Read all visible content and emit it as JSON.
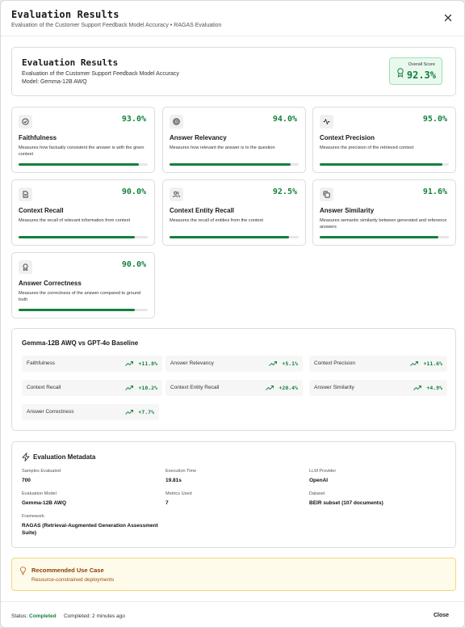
{
  "header": {
    "title": "Evaluation Results",
    "subtitle": "Evaluation of the Customer Support Feedback Model Accuracy • RAGAS Evaluation"
  },
  "summary": {
    "title": "Evaluation Results",
    "description": "Evaluation of the Customer Support Feedback Model Accuracy",
    "model": "Model: Gemma-12B AWQ",
    "overall_label": "Overall Score",
    "overall_value": "92.3%"
  },
  "metrics": [
    {
      "name": "Faithfulness",
      "value": "93.0%",
      "fraction": 0.93,
      "desc": "Measures how factually consistent the answer is with the given context",
      "icon": "check-circle-icon"
    },
    {
      "name": "Answer Relevancy",
      "value": "94.0%",
      "fraction": 0.94,
      "desc": "Measures how relevant the answer is to the question",
      "icon": "target-icon"
    },
    {
      "name": "Context Precision",
      "value": "95.0%",
      "fraction": 0.95,
      "desc": "Measures the precision of the retrieved context",
      "icon": "activity-icon"
    },
    {
      "name": "Context Recall",
      "value": "90.0%",
      "fraction": 0.9,
      "desc": "Measures the recall of relevant information from context",
      "icon": "document-icon"
    },
    {
      "name": "Context Entity Recall",
      "value": "92.5%",
      "fraction": 0.925,
      "desc": "Measures the recall of entities from the context",
      "icon": "users-icon"
    },
    {
      "name": "Answer Similarity",
      "value": "91.6%",
      "fraction": 0.916,
      "desc": "Measures semantic similarity between generated and reference answers",
      "icon": "copy-icon"
    },
    {
      "name": "Answer Correctness",
      "value": "90.0%",
      "fraction": 0.9,
      "desc": "Measures the correctness of the answer compared to ground truth",
      "icon": "award-icon"
    }
  ],
  "comparison": {
    "title": "Gemma-12B AWQ vs GPT-4o Baseline",
    "items": [
      {
        "label": "Faithfulness",
        "delta": "+11.8%"
      },
      {
        "label": "Answer Relevancy",
        "delta": "+5.1%"
      },
      {
        "label": "Context Precision",
        "delta": "+11.6%"
      },
      {
        "label": "Context Recall",
        "delta": "+10.2%"
      },
      {
        "label": "Context Entity Recall",
        "delta": "+20.4%"
      },
      {
        "label": "Answer Similarity",
        "delta": "+4.9%"
      },
      {
        "label": "Answer Correctness",
        "delta": "+7.7%"
      }
    ]
  },
  "metadata": {
    "title": "Evaluation Metadata",
    "fields": [
      {
        "label": "Samples Evaluated",
        "value": "700"
      },
      {
        "label": "Execution Time",
        "value": "19.81s"
      },
      {
        "label": "LLM Provider",
        "value": "OpenAI"
      },
      {
        "label": "Evaluation Model",
        "value": "Gemma-12B AWQ"
      },
      {
        "label": "Metrics Used",
        "value": "7"
      },
      {
        "label": "Dataset",
        "value": "BEIR subset (107 documents)"
      },
      {
        "label": "Framework",
        "value": "RAGAS (Retrieval-Augmented Generation Assessment Suite)"
      }
    ]
  },
  "recommended": {
    "title": "Recommended Use Case",
    "text": "Resource-constrained deployments"
  },
  "footer": {
    "status_label": "Status:",
    "status_value": "Completed",
    "completed": "Completed: 2 minutes ago",
    "close_label": "Close"
  },
  "colors": {
    "accent_green": "#15803d",
    "score_bg": "#e9f9ee",
    "warning_bg": "#fffbea",
    "warning_border": "#f3d77a"
  }
}
